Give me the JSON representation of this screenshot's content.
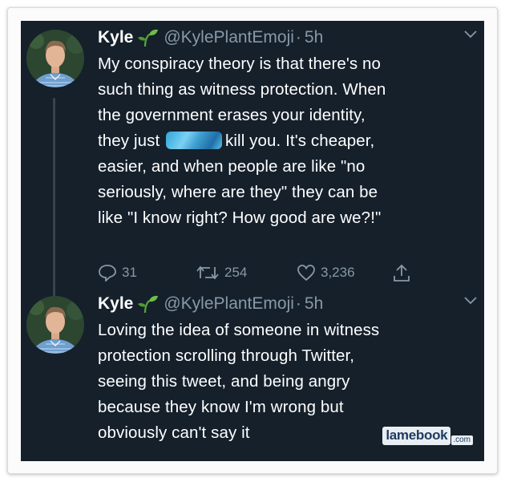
{
  "tweets": [
    {
      "name": "Kyle",
      "emoji_icon": "seedling-icon",
      "handle": "@KylePlantEmoji",
      "separator": "·",
      "time": "5h",
      "text_lines": [
        "My conspiracy theory is that there's no",
        "such thing as witness protection. When",
        "the government erases your identity,",
        "kill you. It's cheaper,",
        "easier, and when people are like \"no",
        "seriously, where are they\" they can be",
        "like \"I know right? How good are we?!\""
      ],
      "line4_prefix": "they just",
      "replies": "31",
      "retweets": "254",
      "likes": "3,236"
    },
    {
      "name": "Kyle",
      "emoji_icon": "seedling-icon",
      "handle": "@KylePlantEmoji",
      "separator": "·",
      "time": "5h",
      "text_lines": [
        "Loving the idea of someone in witness",
        "protection scrolling through Twitter,",
        "seeing this tweet, and being angry",
        "because they know I'm wrong but",
        "obviously can't say it"
      ]
    }
  ],
  "watermark": {
    "main": "lamebook",
    "suffix": ".com"
  },
  "colors": {
    "background": "#15202b",
    "text": "#ffffff",
    "muted": "#8899a6",
    "thread_line": "#38444d"
  }
}
